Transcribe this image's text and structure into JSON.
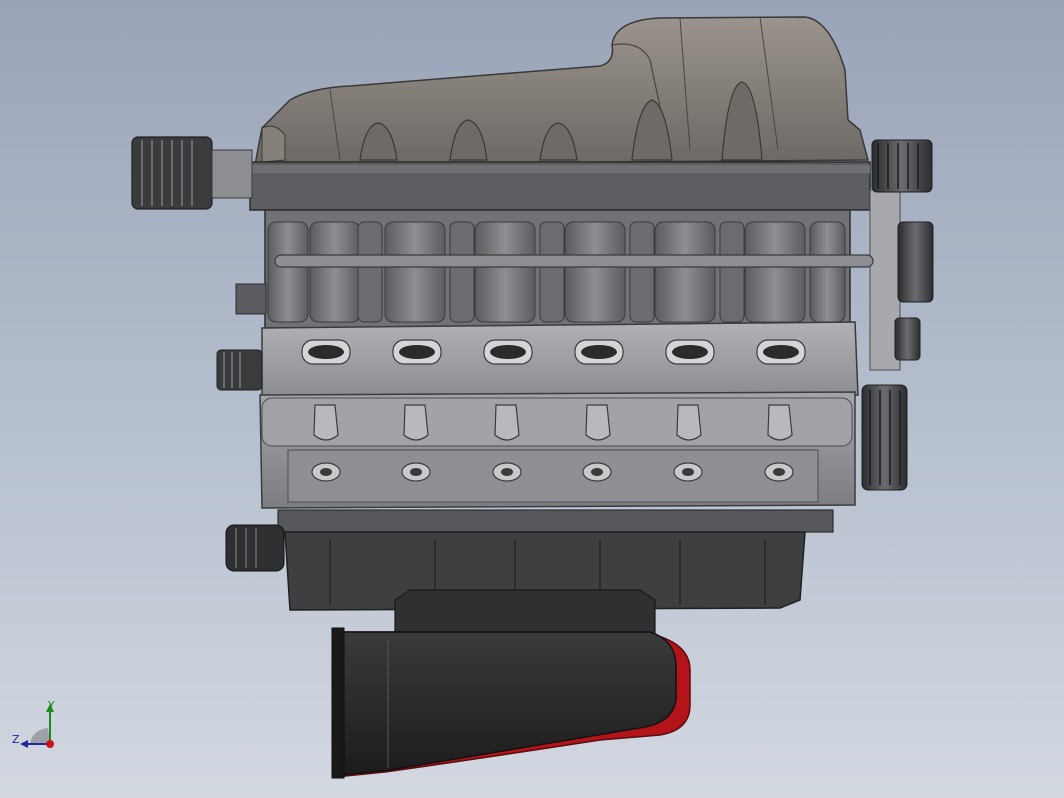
{
  "viewport": {
    "background_top": "#9aa4b8",
    "background_bottom": "#d3d8e1"
  },
  "model": {
    "icon": "v6-engine-assembly",
    "colors": {
      "body": "#8e9093",
      "body_dark": "#4a4c4f",
      "manifold": "#7c7672",
      "intake": "#2a2a2b",
      "accent_red": "#b2141a"
    }
  },
  "triad": {
    "y_label": "Y",
    "z_label": "Z",
    "y_color": "#1d8a1d",
    "z_color": "#1f2a9a",
    "x_color": "#c8141a"
  }
}
